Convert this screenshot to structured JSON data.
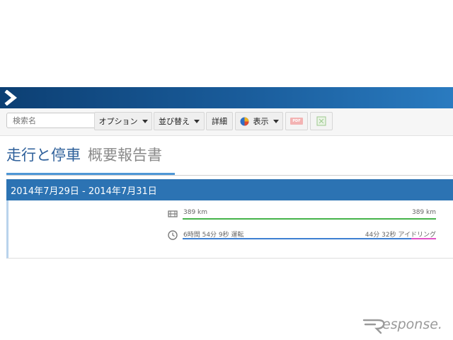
{
  "toolbar": {
    "search_placeholder": "検索名",
    "options_label": "オプション",
    "sort_label": "並び替え",
    "details_label": "詳細",
    "display_label": "表示",
    "pdf_label": "PDF"
  },
  "report": {
    "title": "走行と停車",
    "subtitle": "概要報告書",
    "date_range": "2014年7月29日 - 2014年7月31日"
  },
  "summary": {
    "distance_left": "389 km",
    "distance_right": "389 km",
    "driving_time": "6時間 54分 9秒 運転",
    "idling_time": "44分 32秒 アイドリング",
    "idle_fraction": 0.097
  },
  "colors": {
    "header_blue": "#1a5d9c",
    "range_bar": "#2c73b3",
    "distance_line": "#46b34a",
    "driving_line": "#3d7fd1",
    "idling_line": "#e052c6",
    "title_blue": "#2d5f9a"
  },
  "watermark": {
    "text": "esponse."
  }
}
